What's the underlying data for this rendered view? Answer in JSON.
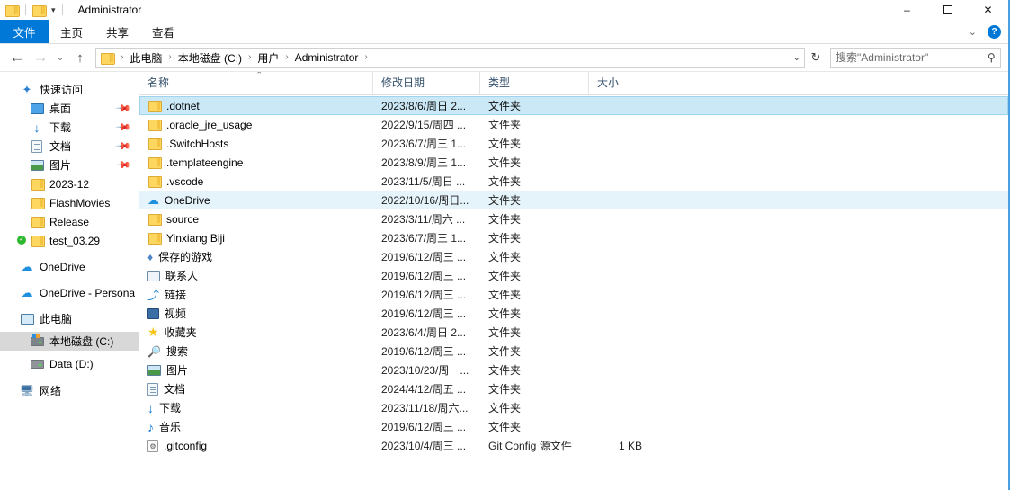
{
  "window": {
    "title": "Administrator",
    "quick_access": [
      "folder-icon",
      "folder-icon"
    ],
    "controls": {
      "minimize": "–",
      "maximize": "❑",
      "close": "✕"
    }
  },
  "ribbon": {
    "tabs": [
      {
        "label": "文件",
        "active": true
      },
      {
        "label": "主页",
        "active": false
      },
      {
        "label": "共享",
        "active": false
      },
      {
        "label": "查看",
        "active": false
      }
    ],
    "collapse_chevron": "⌄",
    "help_label": "?"
  },
  "address": {
    "back": "←",
    "forward": "→",
    "recent": "⌄",
    "up": "↑",
    "breadcrumbs": [
      "此电脑",
      "本地磁盘 (C:)",
      "用户",
      "Administrator"
    ],
    "separator": "›",
    "dropdown": "⌄",
    "refresh": "↻"
  },
  "search": {
    "placeholder": "搜索\"Administrator\"",
    "value": "",
    "icon": "⚲"
  },
  "sidebar": {
    "items": [
      {
        "label": "快速访问",
        "icon": "pinned-star-icon",
        "level": 0,
        "pinned": false,
        "selected": false
      },
      {
        "label": "桌面",
        "icon": "desktop-icon",
        "level": 1,
        "pinned": true,
        "selected": false
      },
      {
        "label": "下载",
        "icon": "downloads-icon",
        "level": 1,
        "pinned": true,
        "selected": false
      },
      {
        "label": "文档",
        "icon": "documents-icon",
        "level": 1,
        "pinned": true,
        "selected": false
      },
      {
        "label": "图片",
        "icon": "pictures-icon",
        "level": 1,
        "pinned": true,
        "selected": false
      },
      {
        "label": "2023-12",
        "icon": "folder-icon",
        "level": 1,
        "pinned": false,
        "selected": false
      },
      {
        "label": "FlashMovies",
        "icon": "folder-icon",
        "level": 1,
        "pinned": false,
        "selected": false
      },
      {
        "label": "Release",
        "icon": "folder-icon",
        "level": 1,
        "pinned": false,
        "selected": false
      },
      {
        "label": "test_03.29",
        "icon": "folder-synced-icon",
        "level": 1,
        "pinned": false,
        "selected": false
      },
      {
        "label": "OneDrive",
        "icon": "cloud-icon",
        "level": 0,
        "pinned": false,
        "selected": false
      },
      {
        "label": "OneDrive - Persona",
        "icon": "cloud-icon",
        "level": 0,
        "pinned": false,
        "selected": false
      },
      {
        "label": "此电脑",
        "icon": "this-pc-icon",
        "level": 0,
        "pinned": false,
        "selected": false
      },
      {
        "label": "本地磁盘 (C:)",
        "icon": "system-drive-icon",
        "level": 1,
        "pinned": false,
        "selected": true
      },
      {
        "label": "Data (D:)",
        "icon": "drive-icon",
        "level": 1,
        "pinned": false,
        "selected": false
      },
      {
        "label": "网络",
        "icon": "network-icon",
        "level": 0,
        "pinned": false,
        "selected": false
      }
    ]
  },
  "filelist": {
    "columns": [
      {
        "key": "name",
        "label": "名称",
        "sorted": "asc"
      },
      {
        "key": "date",
        "label": "修改日期",
        "sorted": ""
      },
      {
        "key": "type",
        "label": "类型",
        "sorted": ""
      },
      {
        "key": "size",
        "label": "大小",
        "sorted": ""
      }
    ],
    "sort_caret": "⌃",
    "rows": [
      {
        "name": ".dotnet",
        "date": "2023/8/6/周日 2...",
        "type": "文件夹",
        "size": "",
        "icon": "folder-icon",
        "state": "selected"
      },
      {
        "name": ".oracle_jre_usage",
        "date": "2022/9/15/周四 ...",
        "type": "文件夹",
        "size": "",
        "icon": "folder-icon",
        "state": ""
      },
      {
        "name": ".SwitchHosts",
        "date": "2023/6/7/周三 1...",
        "type": "文件夹",
        "size": "",
        "icon": "folder-icon",
        "state": ""
      },
      {
        "name": ".templateengine",
        "date": "2023/8/9/周三 1...",
        "type": "文件夹",
        "size": "",
        "icon": "folder-icon",
        "state": ""
      },
      {
        "name": ".vscode",
        "date": "2023/11/5/周日 ...",
        "type": "文件夹",
        "size": "",
        "icon": "folder-icon",
        "state": ""
      },
      {
        "name": "OneDrive",
        "date": "2022/10/16/周日...",
        "type": "文件夹",
        "size": "",
        "icon": "cloud-icon",
        "state": "hover"
      },
      {
        "name": "source",
        "date": "2023/3/11/周六 ...",
        "type": "文件夹",
        "size": "",
        "icon": "folder-icon",
        "state": ""
      },
      {
        "name": "Yinxiang Biji",
        "date": "2023/6/7/周三 1...",
        "type": "文件夹",
        "size": "",
        "icon": "folder-icon",
        "state": ""
      },
      {
        "name": "保存的游戏",
        "date": "2019/6/12/周三 ...",
        "type": "文件夹",
        "size": "",
        "icon": "saved-games-icon",
        "state": ""
      },
      {
        "name": "联系人",
        "date": "2019/6/12/周三 ...",
        "type": "文件夹",
        "size": "",
        "icon": "contacts-icon",
        "state": ""
      },
      {
        "name": "链接",
        "date": "2019/6/12/周三 ...",
        "type": "文件夹",
        "size": "",
        "icon": "links-icon",
        "state": ""
      },
      {
        "name": "视频",
        "date": "2019/6/12/周三 ...",
        "type": "文件夹",
        "size": "",
        "icon": "videos-icon",
        "state": ""
      },
      {
        "name": "收藏夹",
        "date": "2023/6/4/周日 2...",
        "type": "文件夹",
        "size": "",
        "icon": "favorites-icon",
        "state": ""
      },
      {
        "name": "搜索",
        "date": "2019/6/12/周三 ...",
        "type": "文件夹",
        "size": "",
        "icon": "searches-icon",
        "state": ""
      },
      {
        "name": "图片",
        "date": "2023/10/23/周一...",
        "type": "文件夹",
        "size": "",
        "icon": "pictures-icon",
        "state": ""
      },
      {
        "name": "文档",
        "date": "2024/4/12/周五 ...",
        "type": "文件夹",
        "size": "",
        "icon": "documents-icon",
        "state": ""
      },
      {
        "name": "下载",
        "date": "2023/11/18/周六...",
        "type": "文件夹",
        "size": "",
        "icon": "downloads-icon",
        "state": ""
      },
      {
        "name": "音乐",
        "date": "2019/6/12/周三 ...",
        "type": "文件夹",
        "size": "",
        "icon": "music-icon",
        "state": ""
      },
      {
        "name": ".gitconfig",
        "date": "2023/10/4/周三 ...",
        "type": "Git Config 源文件",
        "size": "1 KB",
        "icon": "gitconfig-icon",
        "state": ""
      }
    ]
  },
  "colors": {
    "accent": "#0078d7",
    "selection": "#cbe8f6",
    "selection_border": "#a0d4ee",
    "hover": "#e5f3fb",
    "sidebar_selected": "#d8d8d8",
    "header_text": "#34506b"
  }
}
